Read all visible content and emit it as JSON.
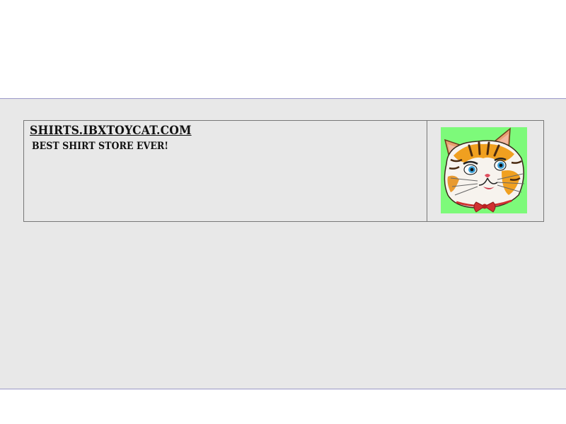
{
  "header": {
    "site_link": "SHIRTS.IBXTOYCAT.COM",
    "tagline": "BEST SHIRT STORE EVER!"
  },
  "colors": {
    "band_background": "#e8e8e8",
    "band_border": "#9a97c7",
    "box_border": "#777777",
    "logo_background": "#7dfa7a"
  },
  "logo": {
    "icon": "cat-face-with-bowtie"
  }
}
